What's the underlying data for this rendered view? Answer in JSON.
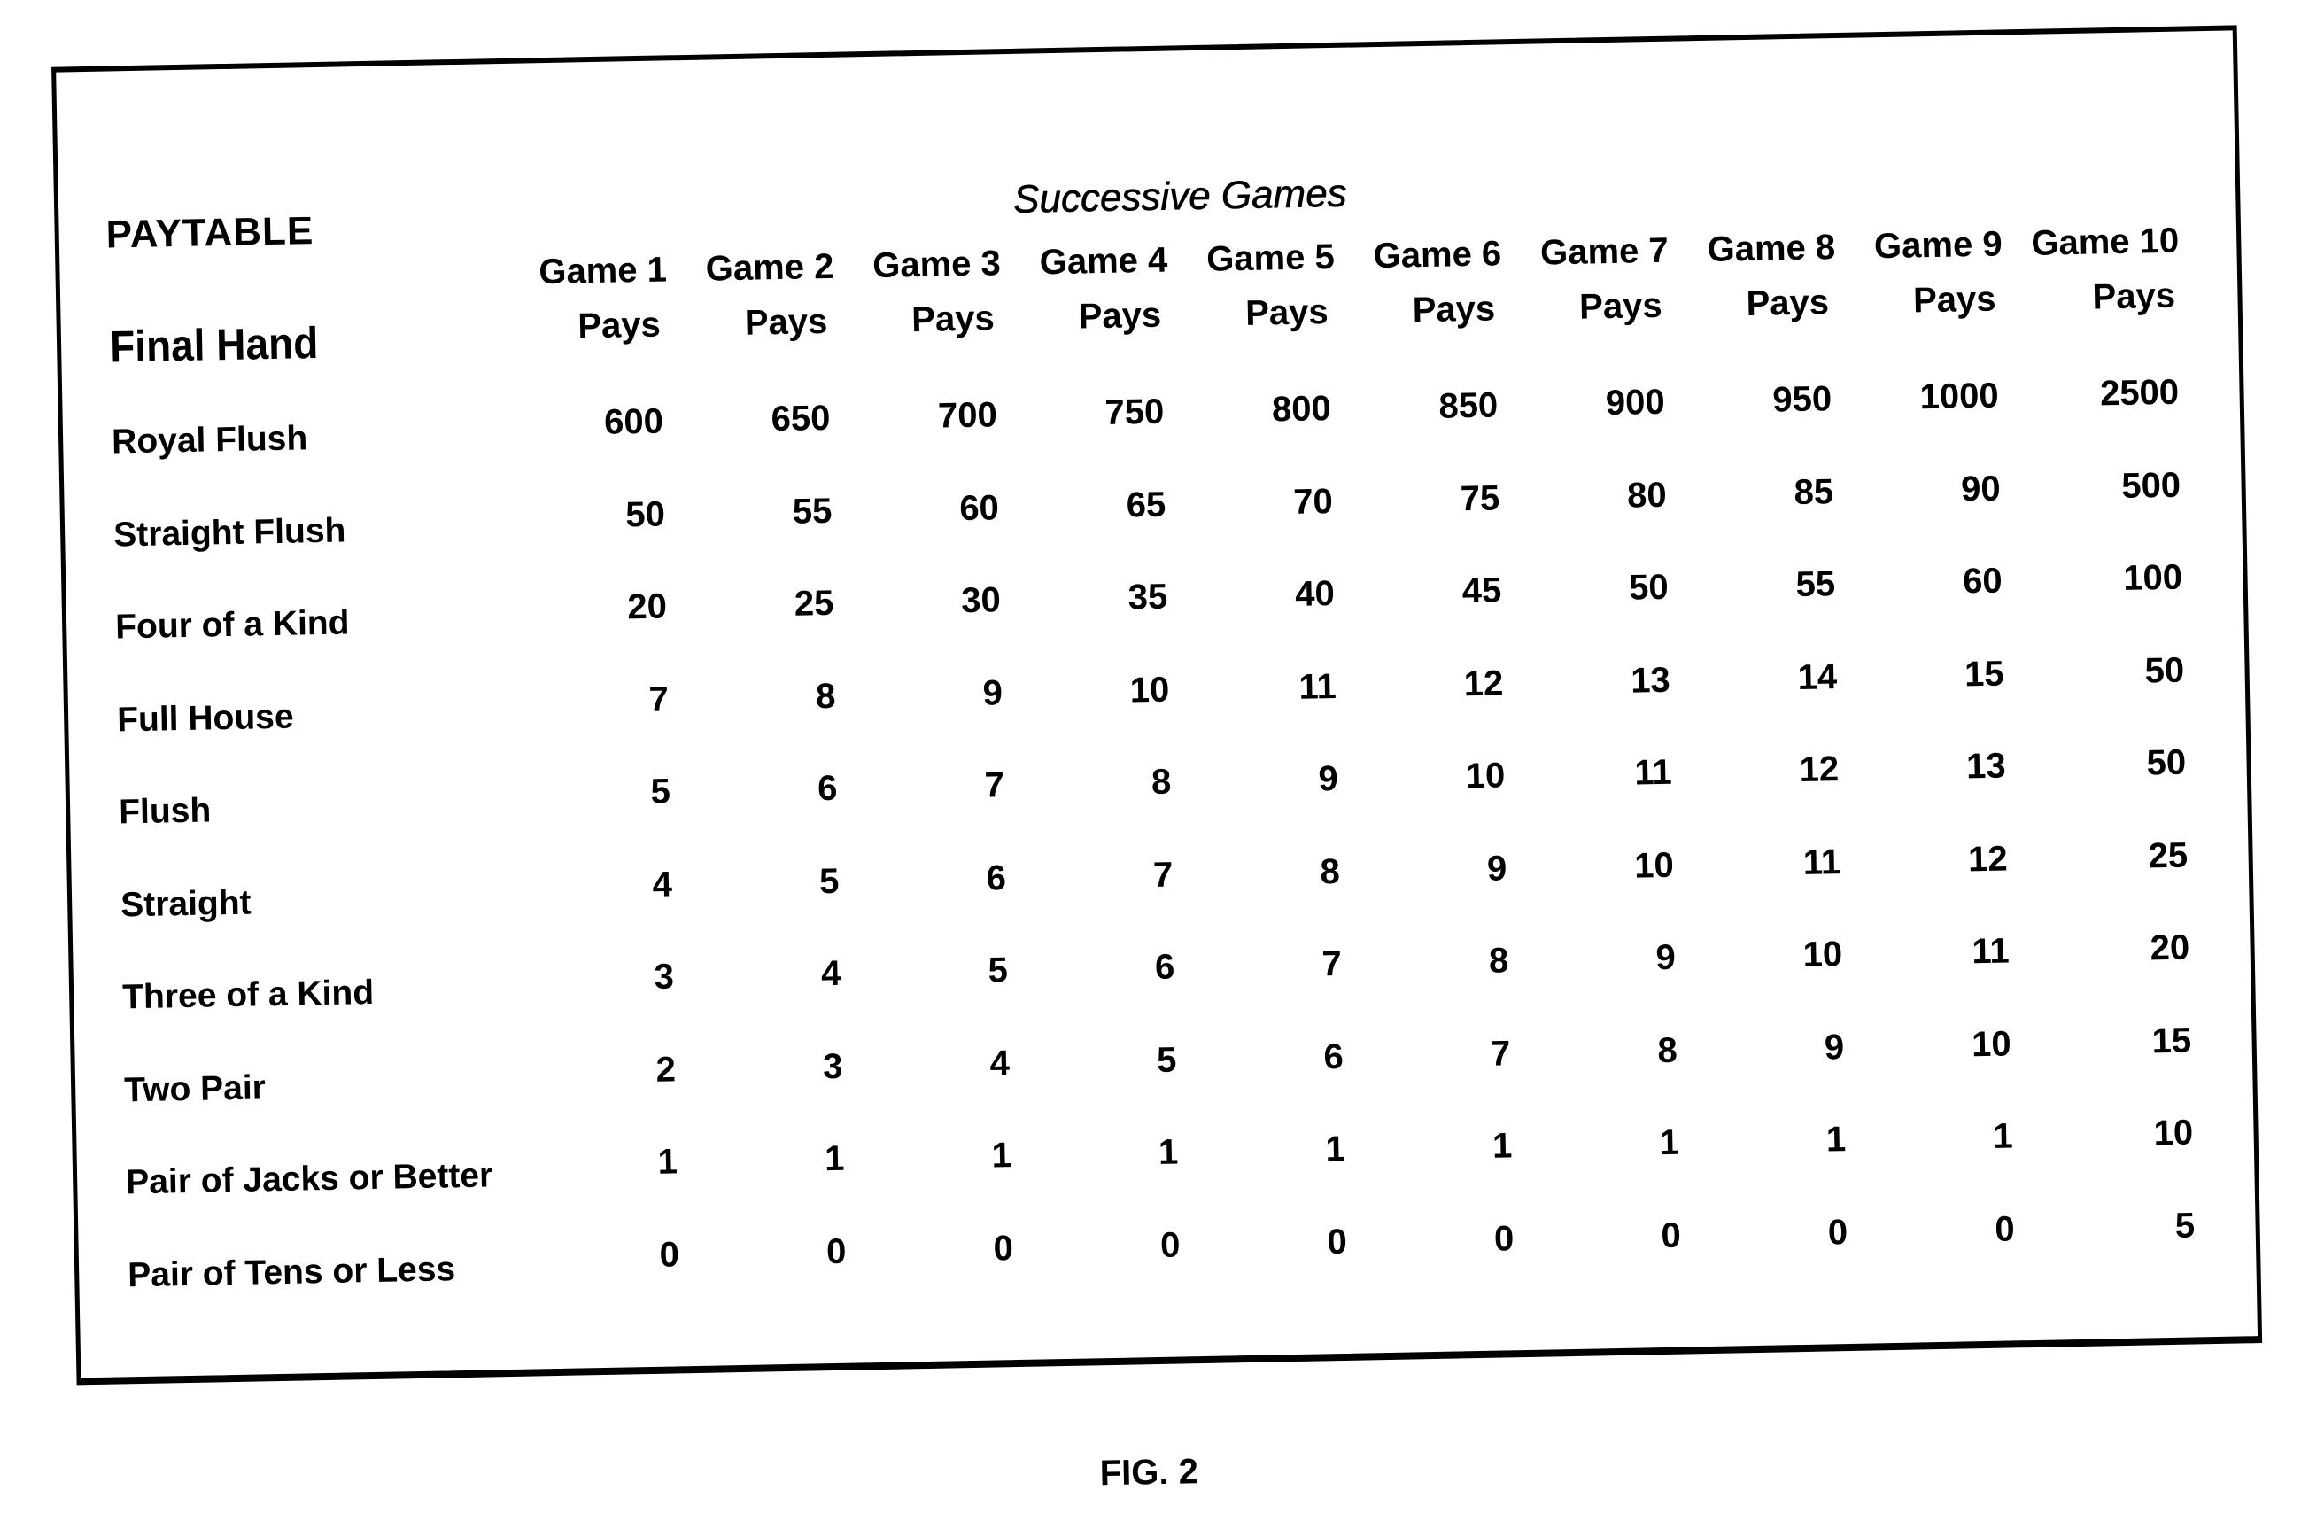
{
  "title": "PAYTABLE",
  "group_header": "Successive Games",
  "row_header": "Final Hand",
  "columns": [
    {
      "game": "Game 1",
      "sub": "Pays"
    },
    {
      "game": "Game 2",
      "sub": "Pays"
    },
    {
      "game": "Game 3",
      "sub": "Pays"
    },
    {
      "game": "Game 4",
      "sub": "Pays"
    },
    {
      "game": "Game 5",
      "sub": "Pays"
    },
    {
      "game": "Game 6",
      "sub": "Pays"
    },
    {
      "game": "Game 7",
      "sub": "Pays"
    },
    {
      "game": "Game 8",
      "sub": "Pays"
    },
    {
      "game": "Game 9",
      "sub": "Pays"
    },
    {
      "game": "Game 10",
      "sub": "Pays"
    }
  ],
  "rows": [
    {
      "hand": "Royal Flush",
      "pays": [
        "600",
        "650",
        "700",
        "750",
        "800",
        "850",
        "900",
        "950",
        "1000",
        "2500"
      ]
    },
    {
      "hand": "Straight Flush",
      "pays": [
        "50",
        "55",
        "60",
        "65",
        "70",
        "75",
        "80",
        "85",
        "90",
        "500"
      ]
    },
    {
      "hand": "Four of a Kind",
      "pays": [
        "20",
        "25",
        "30",
        "35",
        "40",
        "45",
        "50",
        "55",
        "60",
        "100"
      ]
    },
    {
      "hand": "Full House",
      "pays": [
        "7",
        "8",
        "9",
        "10",
        "11",
        "12",
        "13",
        "14",
        "15",
        "50"
      ]
    },
    {
      "hand": "Flush",
      "pays": [
        "5",
        "6",
        "7",
        "8",
        "9",
        "10",
        "11",
        "12",
        "13",
        "50"
      ]
    },
    {
      "hand": "Straight",
      "pays": [
        "4",
        "5",
        "6",
        "7",
        "8",
        "9",
        "10",
        "11",
        "12",
        "25"
      ]
    },
    {
      "hand": "Three of a Kind",
      "pays": [
        "3",
        "4",
        "5",
        "6",
        "7",
        "8",
        "9",
        "10",
        "11",
        "20"
      ]
    },
    {
      "hand": "Two Pair",
      "pays": [
        "2",
        "3",
        "4",
        "5",
        "6",
        "7",
        "8",
        "9",
        "10",
        "15"
      ]
    },
    {
      "hand": "Pair of Jacks or Better",
      "pays": [
        "1",
        "1",
        "1",
        "1",
        "1",
        "1",
        "1",
        "1",
        "1",
        "10"
      ]
    },
    {
      "hand": "Pair of Tens or Less",
      "pays": [
        "0",
        "0",
        "0",
        "0",
        "0",
        "0",
        "0",
        "0",
        "0",
        "5"
      ]
    }
  ],
  "caption": "FIG. 2",
  "chart_data": {
    "type": "table",
    "title": "PAYTABLE",
    "columns": [
      "Final Hand",
      "Game 1 Pays",
      "Game 2 Pays",
      "Game 3 Pays",
      "Game 4 Pays",
      "Game 5 Pays",
      "Game 6 Pays",
      "Game 7 Pays",
      "Game 8 Pays",
      "Game 9 Pays",
      "Game 10 Pays"
    ],
    "rows": [
      [
        "Royal Flush",
        600,
        650,
        700,
        750,
        800,
        850,
        900,
        950,
        1000,
        2500
      ],
      [
        "Straight Flush",
        50,
        55,
        60,
        65,
        70,
        75,
        80,
        85,
        90,
        500
      ],
      [
        "Four of a Kind",
        20,
        25,
        30,
        35,
        40,
        45,
        50,
        55,
        60,
        100
      ],
      [
        "Full House",
        7,
        8,
        9,
        10,
        11,
        12,
        13,
        14,
        15,
        50
      ],
      [
        "Flush",
        5,
        6,
        7,
        8,
        9,
        10,
        11,
        12,
        13,
        50
      ],
      [
        "Straight",
        4,
        5,
        6,
        7,
        8,
        9,
        10,
        11,
        12,
        25
      ],
      [
        "Three of a Kind",
        3,
        4,
        5,
        6,
        7,
        8,
        9,
        10,
        11,
        20
      ],
      [
        "Two Pair",
        2,
        3,
        4,
        5,
        6,
        7,
        8,
        9,
        10,
        15
      ],
      [
        "Pair of Jacks or Better",
        1,
        1,
        1,
        1,
        1,
        1,
        1,
        1,
        1,
        10
      ],
      [
        "Pair of Tens or Less",
        0,
        0,
        0,
        0,
        0,
        0,
        0,
        0,
        0,
        5
      ]
    ]
  }
}
